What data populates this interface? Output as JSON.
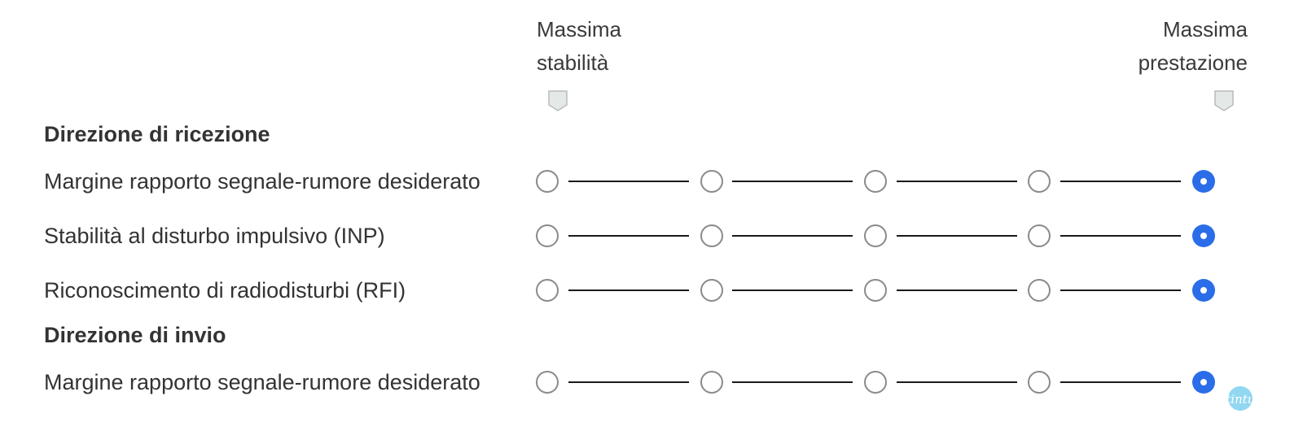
{
  "header": {
    "left_label_line1": "Massima",
    "left_label_line2": "stabilità",
    "right_label_line1": "Massima",
    "right_label_line2": "prestazione"
  },
  "sections": [
    {
      "title": "Direzione di ricezione",
      "rows": [
        {
          "label": "Margine rapporto segnale-rumore desiderato",
          "selected_index": 4
        },
        {
          "label": "Stabilità al disturbo impulsivo (INP)",
          "selected_index": 4
        },
        {
          "label": "Riconoscimento di radiodisturbi (RFI)",
          "selected_index": 4
        }
      ]
    },
    {
      "title": "Direzione di invio",
      "rows": [
        {
          "label": "Margine rapporto segnale-rumore desiderato",
          "selected_index": 4
        }
      ]
    }
  ],
  "scale_steps": 5,
  "watermark": {
    "text": "Stintup"
  },
  "colors": {
    "accent": "#2b6de8",
    "radio_border": "#8a8a8a",
    "connector": "#1a1a1a",
    "text": "#333333"
  }
}
